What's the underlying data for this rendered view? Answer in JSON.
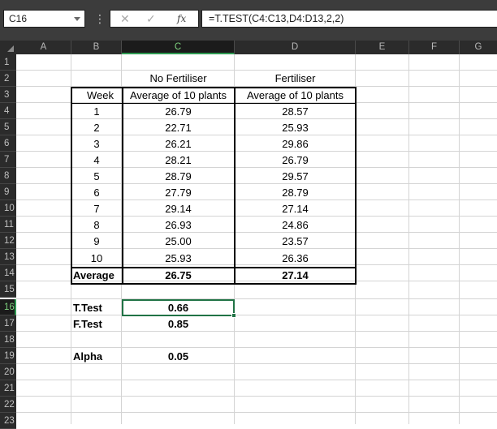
{
  "formula_bar": {
    "name_box": "C16",
    "formula": "=T.TEST(C4:C13,D4:D13,2,2)",
    "fx_label": "fx"
  },
  "columns": [
    "A",
    "B",
    "C",
    "D",
    "E",
    "F",
    "G"
  ],
  "rows": [
    "1",
    "2",
    "3",
    "4",
    "5",
    "6",
    "7",
    "8",
    "9",
    "10",
    "11",
    "12",
    "13",
    "14",
    "15",
    "16",
    "17",
    "18",
    "19",
    "20",
    "21",
    "22",
    "23"
  ],
  "sheet": {
    "header_no_fert": "No Fertiliser",
    "header_fert": "Fertiliser",
    "col_week": "Week",
    "col_avg1": "Average of 10 plants",
    "col_avg2": "Average of 10 plants",
    "data": [
      {
        "week": "1",
        "no_fert": "26.79",
        "fert": "28.57"
      },
      {
        "week": "2",
        "no_fert": "22.71",
        "fert": "25.93"
      },
      {
        "week": "3",
        "no_fert": "26.21",
        "fert": "29.86"
      },
      {
        "week": "4",
        "no_fert": "28.21",
        "fert": "26.79"
      },
      {
        "week": "5",
        "no_fert": "28.79",
        "fert": "29.57"
      },
      {
        "week": "6",
        "no_fert": "27.79",
        "fert": "28.79"
      },
      {
        "week": "7",
        "no_fert": "29.14",
        "fert": "27.14"
      },
      {
        "week": "8",
        "no_fert": "26.93",
        "fert": "24.86"
      },
      {
        "week": "9",
        "no_fert": "25.00",
        "fert": "23.57"
      },
      {
        "week": "10",
        "no_fert": "25.93",
        "fert": "26.36"
      }
    ],
    "avg_label": "Average",
    "avg_no_fert": "26.75",
    "avg_fert": "27.14",
    "ttest_label": "T.Test",
    "ttest_value": "0.66",
    "ftest_label": "F.Test",
    "ftest_value": "0.85",
    "alpha_label": "Alpha",
    "alpha_value": "0.05"
  },
  "colors": {
    "selection": "#217346",
    "header_bg": "#2b2b2b",
    "toolbar_bg": "#3c3c3c"
  }
}
